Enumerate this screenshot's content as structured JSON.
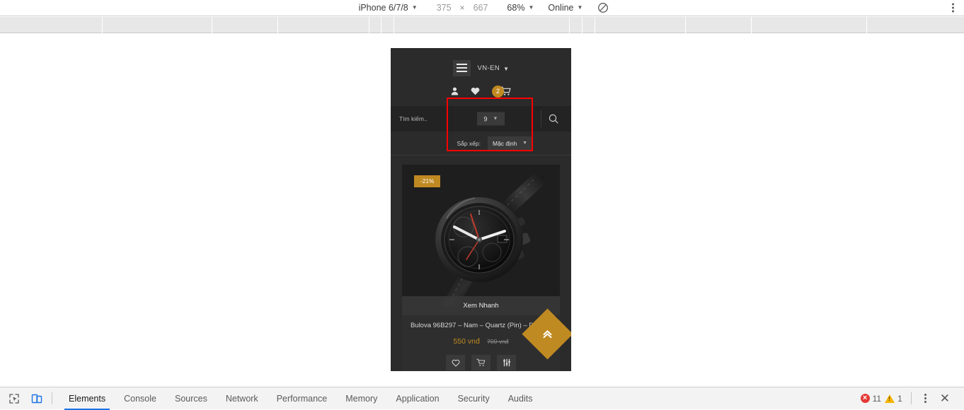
{
  "device_toolbar": {
    "device_name": "iPhone 6/7/8",
    "width": "375",
    "separator": "×",
    "height": "667",
    "zoom": "68%",
    "throttling": "Online",
    "rotate_icon": "rotate-device-icon",
    "more_icon": "more-options-icon"
  },
  "viewport": {
    "header": {
      "menu_icon": "hamburger-menu-icon",
      "language": "VN-EN",
      "caret": "⌄"
    },
    "icon_row": {
      "account_icon": "user-account-icon",
      "wishlist_icon": "heart-icon",
      "cart_icon": "shopping-cart-icon",
      "cart_count": "2"
    },
    "search": {
      "placeholder": "Tìm kiếm..",
      "per_page_value": "9",
      "search_icon": "magnifier-icon",
      "caret": "⌄"
    },
    "sort": {
      "label": "Sắp xếp:",
      "value": "Mặc định",
      "caret": "⌄"
    },
    "product": {
      "discount_badge": "-21%",
      "quick_view": "Xem Nhanh",
      "title": "Bulova 96B297 – Nam – Quartz (Pin) – Dây Da",
      "price_current": "550 vnđ",
      "price_original": "700 vnđ",
      "actions": {
        "wishlist_icon": "heart-outline-icon",
        "add_to_cart_icon": "cart-icon",
        "compare_icon": "compare-sliders-icon"
      },
      "image_alt": "black-chronograph-watch"
    },
    "scroll_top": {
      "icon": "double-chevron-up-icon"
    }
  },
  "devtools": {
    "inspect_icon": "inspect-element-icon",
    "device_toggle_icon": "toggle-device-toolbar-icon",
    "tabs": [
      {
        "label": "Elements",
        "active": true
      },
      {
        "label": "Console",
        "active": false
      },
      {
        "label": "Sources",
        "active": false
      },
      {
        "label": "Network",
        "active": false
      },
      {
        "label": "Performance",
        "active": false
      },
      {
        "label": "Memory",
        "active": false
      },
      {
        "label": "Application",
        "active": false
      },
      {
        "label": "Security",
        "active": false
      },
      {
        "label": "Audits",
        "active": false
      }
    ],
    "error_count": "11",
    "warning_count": "1",
    "more_icon": "more-options-icon",
    "close_icon": "close-devtools-icon"
  },
  "colors": {
    "accent_gold": "#c08a22",
    "highlight_red": "#ff0000",
    "devtools_blue": "#1a73e8",
    "viewport_bg": "#2b2b2b"
  }
}
